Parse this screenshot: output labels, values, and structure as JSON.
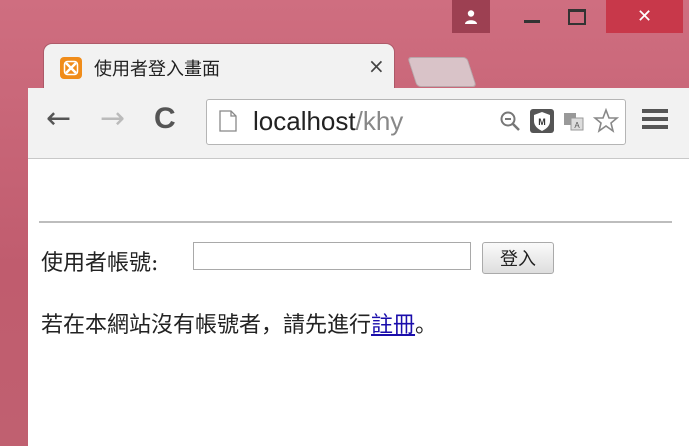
{
  "window": {
    "user_icon": "user-icon",
    "minimize_icon": "minimize-icon",
    "maximize_icon": "maximize-icon",
    "close_label": "✕"
  },
  "tab": {
    "title": "使用者登入畫面",
    "close_label": "×",
    "favicon": "xampp-icon"
  },
  "toolbar": {
    "back_label": "←",
    "forward_label": "→",
    "reload_label": "C",
    "url_host": "localhost",
    "url_path": "/khy",
    "icons": [
      "zoom-icon",
      "extension-shield-icon",
      "translate-icon",
      "bookmark-star-icon",
      "menu-icon"
    ]
  },
  "form": {
    "username_label": "使用者帳號:",
    "username_value": "",
    "login_button": "登入"
  },
  "note": {
    "text": "若在本網站沒有帳號者，請先進行",
    "link_text": "註冊",
    "suffix": "。"
  }
}
